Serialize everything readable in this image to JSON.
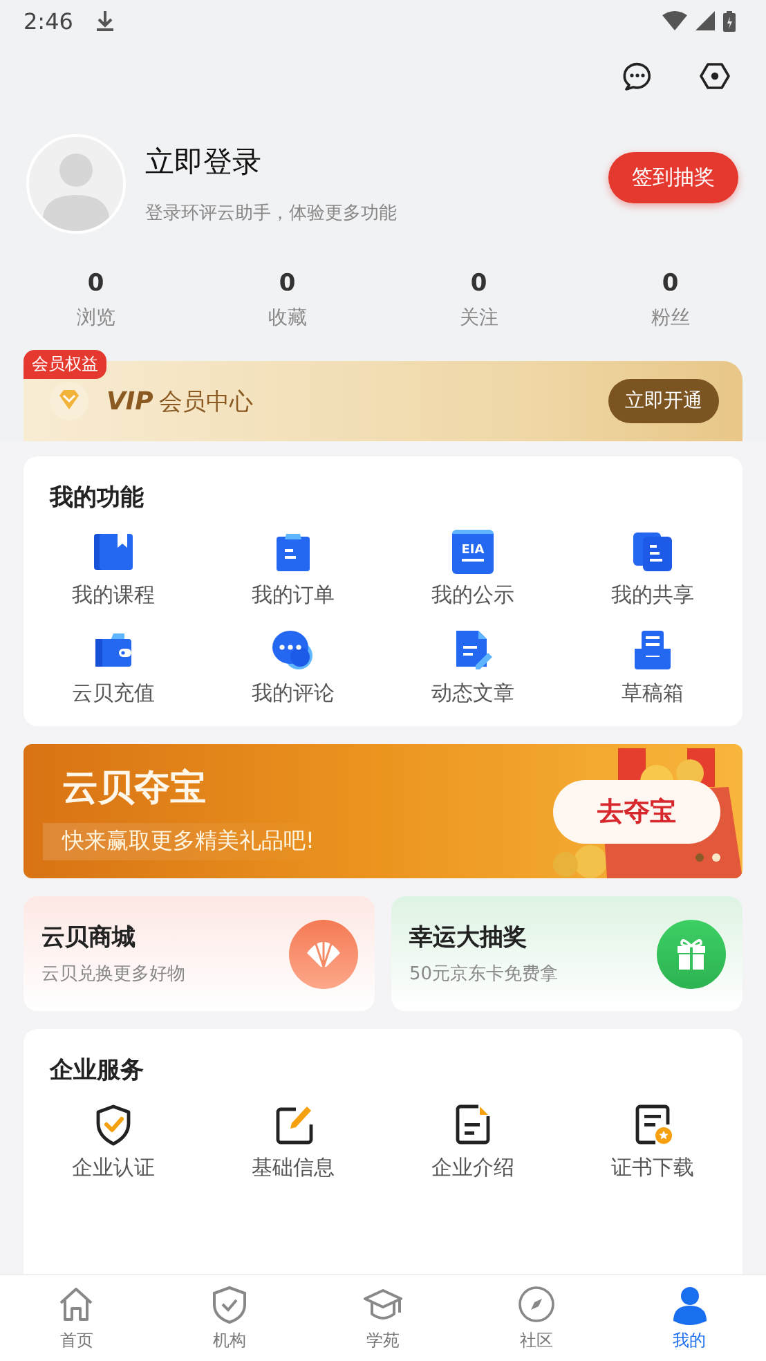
{
  "status_bar": {
    "time": "2:46"
  },
  "profile": {
    "title": "立即登录",
    "subtitle": "登录环评云助手，体验更多功能",
    "checkin_button": "签到抽奖"
  },
  "stats": [
    {
      "value": "0",
      "label": "浏览"
    },
    {
      "value": "0",
      "label": "收藏"
    },
    {
      "value": "0",
      "label": "关注"
    },
    {
      "value": "0",
      "label": "粉丝"
    }
  ],
  "vip": {
    "badge": "会员权益",
    "brand": "VIP",
    "title": "会员中心",
    "button": "立即开通"
  },
  "my_functions": {
    "title": "我的功能",
    "items": [
      {
        "kind": "course",
        "label": "我的课程"
      },
      {
        "kind": "order",
        "label": "我的订单"
      },
      {
        "kind": "notice",
        "label": "我的公示",
        "icon_text": "EIA"
      },
      {
        "kind": "share",
        "label": "我的共享"
      },
      {
        "kind": "wallet",
        "label": "云贝充值"
      },
      {
        "kind": "comment",
        "label": "我的评论"
      },
      {
        "kind": "article",
        "label": "动态文章"
      },
      {
        "kind": "drafts",
        "label": "草稿箱"
      }
    ]
  },
  "banner": {
    "title": "云贝夺宝",
    "subtitle": "快来赢取更多精美礼品吧!",
    "button": "去夺宝",
    "dots": [
      {
        "selected": true
      },
      {
        "selected": false
      }
    ]
  },
  "promo_cards": [
    {
      "kind": "shop",
      "title": "云贝商城",
      "subtitle": "云贝兑换更多好物"
    },
    {
      "kind": "lottery",
      "title": "幸运大抽奖",
      "subtitle": "50元京东卡免费拿"
    }
  ],
  "enterprise_services": {
    "title": "企业服务",
    "items": [
      {
        "kind": "verify",
        "label": "企业认证"
      },
      {
        "kind": "info",
        "label": "基础信息"
      },
      {
        "kind": "intro",
        "label": "企业介绍"
      },
      {
        "kind": "certificate",
        "label": "证书下载"
      }
    ]
  },
  "tab_bar": [
    {
      "kind": "home",
      "label": "首页",
      "selected": false
    },
    {
      "kind": "org",
      "label": "机构",
      "selected": false
    },
    {
      "kind": "academy",
      "label": "学苑",
      "selected": false
    },
    {
      "kind": "community",
      "label": "社区",
      "selected": false
    },
    {
      "kind": "me",
      "label": "我的",
      "selected": true
    }
  ]
}
